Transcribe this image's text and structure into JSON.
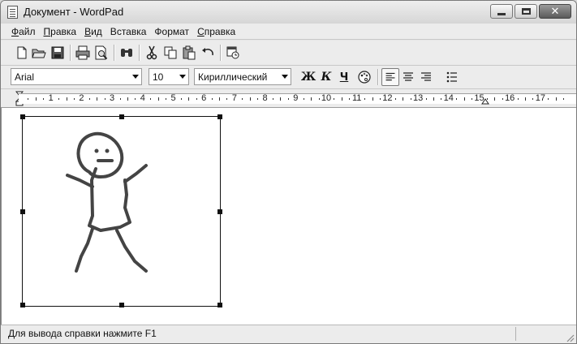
{
  "window": {
    "title": "Документ - WordPad"
  },
  "menu": {
    "items": [
      {
        "label": "Файл",
        "accel": "Ф",
        "rest": "айл"
      },
      {
        "label": "Правка",
        "accel": "П",
        "rest": "равка"
      },
      {
        "label": "Вид",
        "accel": "В",
        "rest": "ид"
      },
      {
        "label": "Вставка",
        "accel": "В",
        "rest": "ставка"
      },
      {
        "label": "Формат",
        "accel": "Ф",
        "rest": "ормат"
      },
      {
        "label": "Справка",
        "accel": "С",
        "rest": "правка"
      }
    ]
  },
  "toolbar": {
    "icons": [
      "new-document-icon",
      "open-folder-icon",
      "save-icon",
      "print-icon",
      "print-preview-icon",
      "find-icon",
      "cut-icon",
      "copy-icon",
      "paste-icon",
      "undo-icon",
      "insert-datetime-icon"
    ]
  },
  "format": {
    "font": "Arial",
    "size": "10",
    "script": "Кириллический",
    "bold": "Ж",
    "italic": "К",
    "underline": "Ч",
    "align_selected": "left"
  },
  "ruler": {
    "numbers": [
      "1",
      "2",
      "3",
      "4",
      "5",
      "6",
      "7",
      "8",
      "9",
      "10",
      "11",
      "12",
      "13",
      "14",
      "15",
      "16",
      "17"
    ]
  },
  "status": {
    "text": "Для вывода справки нажмите F1"
  }
}
